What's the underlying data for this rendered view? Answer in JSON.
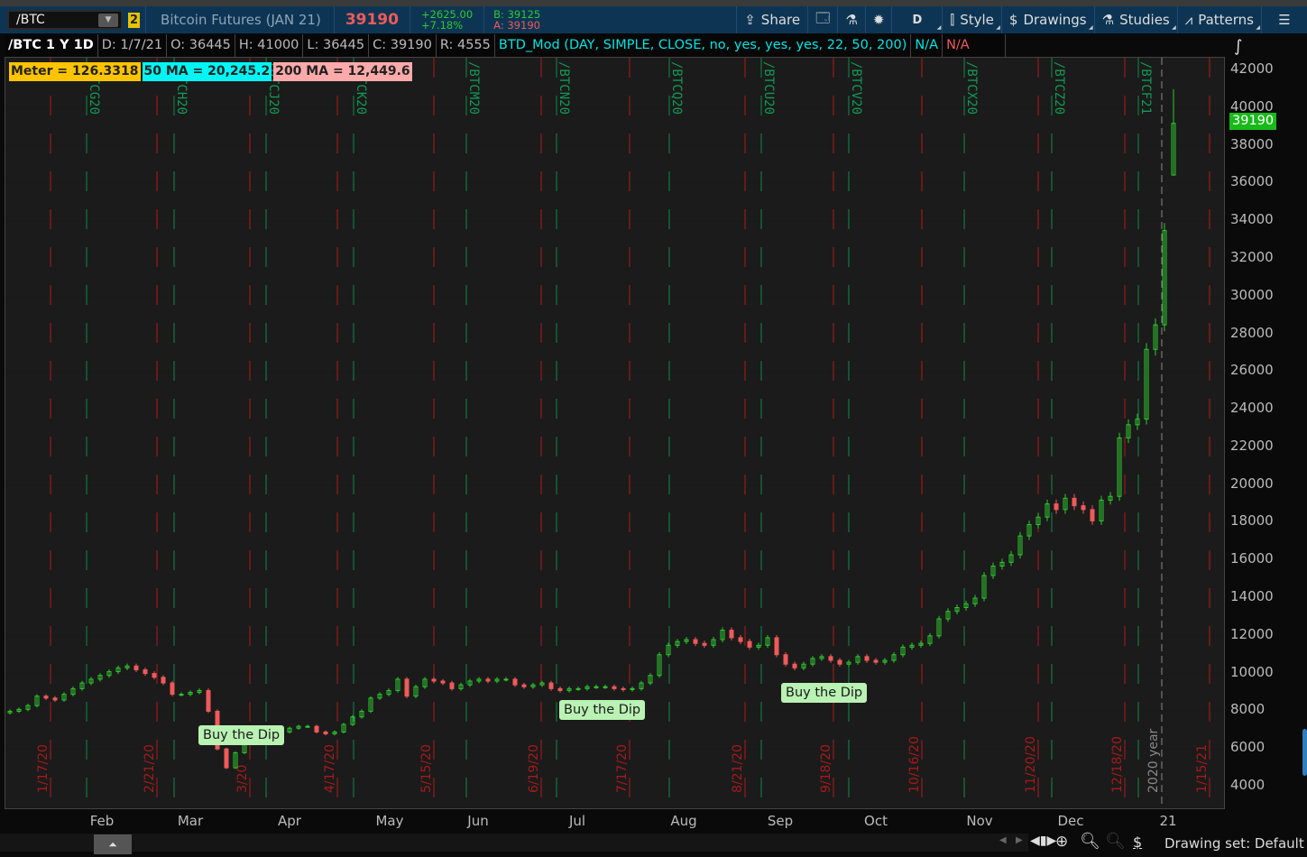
{
  "toolbar": {
    "symbol": "/BTC",
    "link_num": "2",
    "description": "Bitcoin Futures (JAN 21)",
    "last": "39190",
    "change": "+2625.00",
    "change_pct": "+7.18%",
    "bid": "B: 39125",
    "ask": "A: 39190",
    "share": "Share",
    "timeframe": "D",
    "style": "Style",
    "drawings": "Drawings",
    "studies": "Studies",
    "patterns": "Patterns"
  },
  "info": {
    "title": "/BTC 1 Y 1D",
    "date": "D: 1/7/21",
    "open": "O: 36445",
    "high": "H: 41000",
    "low": "L: 36445",
    "close": "C: 39190",
    "range": "R: 4555",
    "study": "BTD_Mod (DAY, SIMPLE, CLOSE, no, yes, yes, yes, 22, 50, 200)",
    "na1": "N/A",
    "na2": "N/A"
  },
  "badges": {
    "meter": "Meter = 126.3318",
    "ma50": "50 MA = 20,245.2",
    "ma200": "200 MA = 12,449.6"
  },
  "colors": {
    "up": "#2ec92e",
    "down": "#f05a5a",
    "toolbar": "#0d3553",
    "expiry_line": "#b01818",
    "roll_line": "#0f8a4a",
    "meter": "#ffc400",
    "ma50": "#00f5f5",
    "ma200": "#ffaaaa",
    "last_price": "#19b919"
  },
  "contract_labels": [
    "/BTCG20",
    "/BTCH20",
    "/BTCJ20",
    "/BTCK20",
    "/BTCM20",
    "/BTCN20",
    "/BTCQ20",
    "/BTCU20",
    "/BTCV20",
    "/BTCX20",
    "/BTCZ20",
    "/BTCF21"
  ],
  "expiry_labels": [
    "1/17/20",
    "2/21/20",
    "3/20",
    "4/17/20",
    "5/15/20",
    "6/19/20",
    "7/17/20",
    "8/21/20",
    "9/18/20",
    "10/16/20",
    "11/20/20",
    "12/18/20",
    "1/15/21"
  ],
  "year_label": "2020 year",
  "buy_the_dip": [
    "Buy the Dip",
    "Buy the Dip",
    "Buy the Dip"
  ],
  "months": [
    "Feb",
    "Mar",
    "Apr",
    "May",
    "Jun",
    "Jul",
    "Aug",
    "Sep",
    "Oct",
    "Nov",
    "Dec",
    "21"
  ],
  "last_price_tag": "39190",
  "bottom": {
    "drawing_set": "Drawing set: Default"
  },
  "chart_data": {
    "type": "candlestick",
    "ylim": [
      3000,
      43000
    ],
    "yticks": [
      4000,
      6000,
      8000,
      10000,
      12000,
      14000,
      16000,
      18000,
      20000,
      22000,
      24000,
      26000,
      28000,
      30000,
      32000,
      34000,
      36000,
      38000,
      40000,
      42000
    ],
    "last_bar": {
      "date": "1/7/21",
      "open": 36445,
      "high": 41000,
      "low": 36445,
      "close": 39190
    },
    "closes": [
      8000,
      8100,
      8300,
      8800,
      8700,
      8600,
      8900,
      9200,
      9500,
      9700,
      9900,
      10100,
      10300,
      10400,
      10200,
      10000,
      9800,
      9500,
      8900,
      8900,
      9000,
      9100,
      8000,
      6000,
      5000,
      5800,
      6300,
      6500,
      6600,
      6700,
      6900,
      7100,
      7200,
      7200,
      6900,
      6800,
      6900,
      7300,
      7700,
      8000,
      8700,
      8900,
      9100,
      9700,
      8800,
      9300,
      9700,
      9600,
      9500,
      9200,
      9400,
      9600,
      9700,
      9600,
      9700,
      9700,
      9400,
      9300,
      9400,
      9500,
      9200,
      9100,
      9200,
      9200,
      9300,
      9300,
      9300,
      9200,
      9150,
      9200,
      9500,
      9900,
      11000,
      11500,
      11700,
      11800,
      11600,
      11500,
      11800,
      12300,
      11900,
      11700,
      11400,
      11500,
      11900,
      11000,
      10500,
      10300,
      10500,
      10800,
      10900,
      10700,
      10500,
      10600,
      10900,
      10700,
      10600,
      10700,
      11000,
      11400,
      11500,
      11600,
      12000,
      12900,
      13300,
      13500,
      13700,
      14000,
      15200,
      15700,
      15900,
      16300,
      17300,
      17900,
      18300,
      19000,
      18700,
      19300,
      18900,
      18700,
      18100,
      19200,
      19400,
      22500,
      23200,
      23500,
      27200,
      28500,
      33500,
      39190
    ]
  }
}
